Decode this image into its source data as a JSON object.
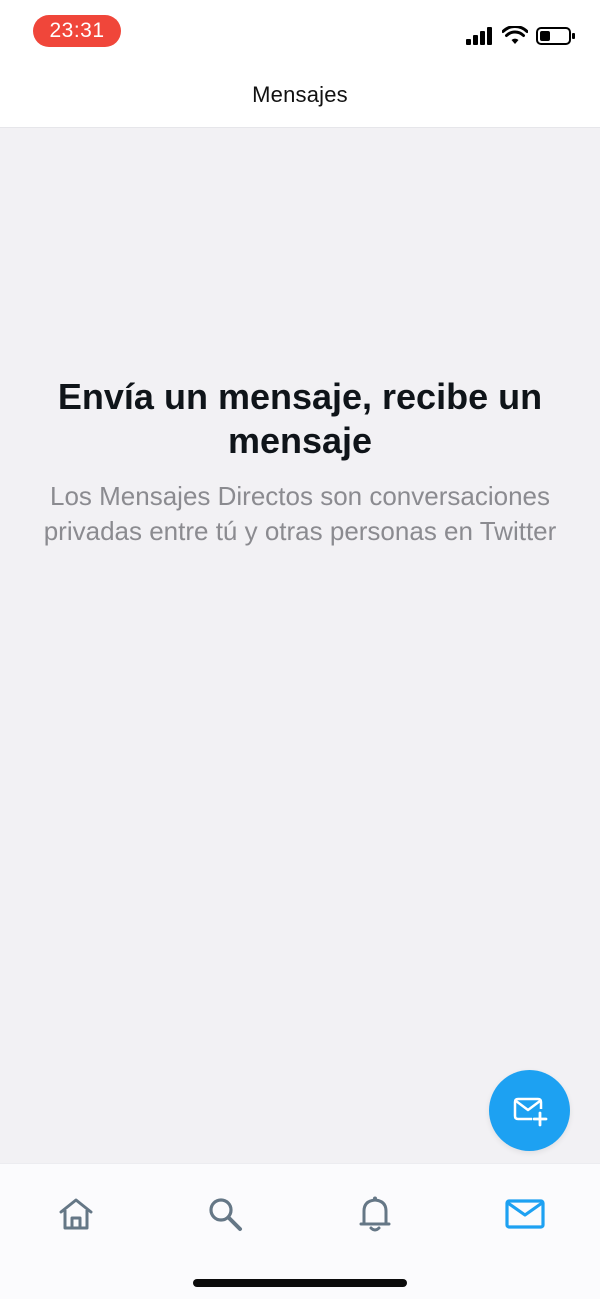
{
  "status_bar": {
    "time": "23:31"
  },
  "header": {
    "title": "Mensajes"
  },
  "empty_state": {
    "title": "Envía un mensaje, recibe un mensaje",
    "subtitle": "Los Mensajes Directos son conversaciones privadas entre tú y otras personas en Twitter"
  },
  "fab": {
    "icon": "compose-message-icon"
  },
  "tabbar": {
    "tabs": [
      {
        "icon": "home-icon",
        "active": false
      },
      {
        "icon": "search-icon",
        "active": false
      },
      {
        "icon": "bell-icon",
        "active": false
      },
      {
        "icon": "mail-icon",
        "active": true
      }
    ]
  },
  "colors": {
    "accent": "#1da1f2",
    "time_pill": "#f0463a",
    "inactive_icon": "#657786"
  }
}
